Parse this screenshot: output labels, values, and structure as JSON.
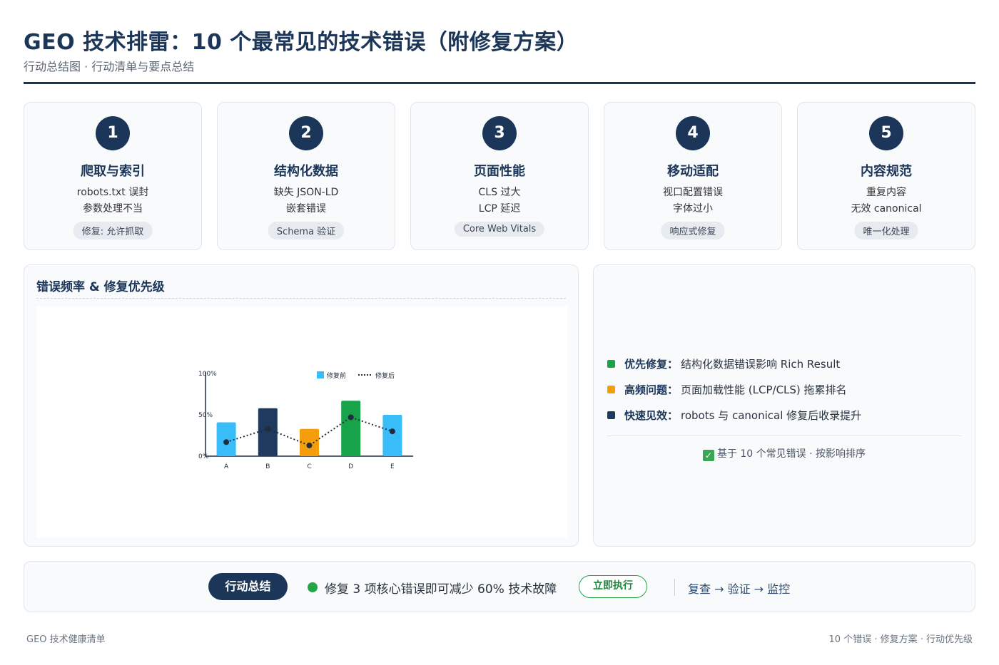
{
  "header": {
    "title": "GEO 技术排雷：10 个最常见的技术错误（附修复方案）",
    "subtitle": "行动总结图 · 行动清单与要点总结"
  },
  "cards": [
    {
      "num": "1",
      "title": "爬取与索引",
      "line1": "robots.txt 误封",
      "line2": "参数处理不当",
      "tag": "修复: 允许抓取"
    },
    {
      "num": "2",
      "title": "结构化数据",
      "line1": "缺失 JSON-LD",
      "line2": "嵌套错误",
      "tag": "Schema 验证"
    },
    {
      "num": "3",
      "title": "页面性能",
      "line1": "CLS 过大",
      "line2": "LCP 延迟",
      "tag": "Core Web Vitals"
    },
    {
      "num": "4",
      "title": "移动适配",
      "line1": "视口配置错误",
      "line2": "字体过小",
      "tag": "响应式修复"
    },
    {
      "num": "5",
      "title": "内容规范",
      "line1": "重复内容",
      "line2": "无效 canonical",
      "tag": "唯一化处理"
    }
  ],
  "chart_panel": {
    "title": "错误频率 & 修复优先级"
  },
  "chart_data": {
    "type": "bar",
    "categories": [
      "A",
      "B",
      "C",
      "D",
      "E"
    ],
    "series": [
      {
        "name": "修复前",
        "values": [
          41,
          58,
          33,
          67,
          50
        ],
        "style": "bar"
      },
      {
        "name": "修复后",
        "values": [
          17,
          33,
          13,
          47,
          30
        ],
        "style": "dotted-line"
      }
    ],
    "ylim": [
      0,
      100
    ],
    "yticks": [
      "0%",
      "50%",
      "100%"
    ],
    "bar_colors": [
      "#38bdf8",
      "#1e3a5f",
      "#f59e0b",
      "#16a34a",
      "#38bdf8"
    ],
    "legend_position": "top-right"
  },
  "summary": {
    "items": [
      {
        "label": "优先修复：",
        "text": "结构化数据错误影响 Rich Result",
        "color": "#16a34a"
      },
      {
        "label": "高频问题：",
        "text": "页面加载性能 (LCP/CLS) 拖累排名",
        "color": "#f59e0b"
      },
      {
        "label": "快速见效：",
        "text": "robots 与 canonical 修复后收录提升",
        "color": "#1e3a5f"
      }
    ],
    "note": "基于 10 个常见错误 · 按影响排序"
  },
  "action": {
    "badge": "行动总结",
    "text": "修复 3 项核心错误即可减少 60% 技术故障",
    "button": "立即执行",
    "flow": "复查 → 验证 → 监控"
  },
  "footer": {
    "left": "GEO 技术健康清单",
    "right": "10 个错误 · 修复方案 · 行动优先级"
  }
}
